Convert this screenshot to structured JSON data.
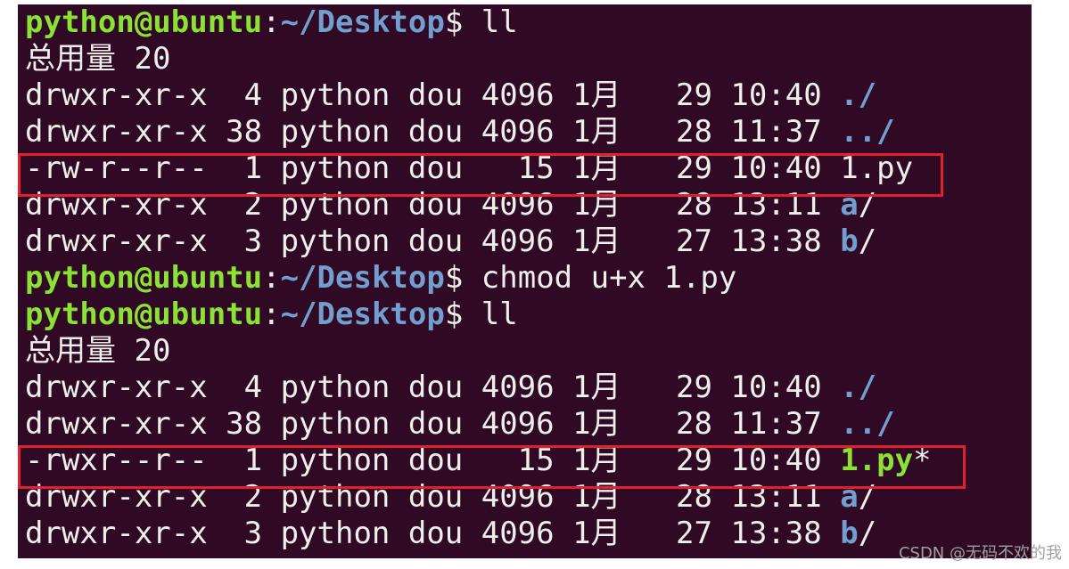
{
  "terminal": {
    "colors": {
      "background": "#300a24",
      "text": "#eeeeec",
      "prompt_user": "#8ae234",
      "prompt_path": "#729fcf",
      "highlight_box": "#e0202e"
    },
    "prompt": {
      "user": "python@ubuntu",
      "colon": ":",
      "path": "~/Desktop",
      "symbol": "$ "
    },
    "cmd1": "ll",
    "total1": "总用量 20",
    "listing1": {
      "row1_perms": "drwxr-xr-x  4 python dou 4096 1月   29 10:40 ",
      "row1_name": "./",
      "row2_perms": "drwxr-xr-x 38 python dou 4096 1月   28 11:37 ",
      "row2_name": "../",
      "row3_perms": "-rw-r--r--  1 python dou   15 1月   29 10:40 ",
      "row3_name": "1.py",
      "row4_perms": "drwxr-xr-x  2 python dou 4096 1月   28 13:11 ",
      "row4_name": "a",
      "row4_slash": "/",
      "row5_perms": "drwxr-xr-x  3 python dou 4096 1月   27 13:38 ",
      "row5_name": "b",
      "row5_slash": "/"
    },
    "cmd2": "chmod u+x 1.py",
    "cmd3": "ll",
    "total2": "总用量 20",
    "listing2": {
      "row1_perms": "drwxr-xr-x  4 python dou 4096 1月   29 10:40 ",
      "row1_name": "./",
      "row2_perms": "drwxr-xr-x 38 python dou 4096 1月   28 11:37 ",
      "row2_name": "../",
      "row3_perms": "-rwxr--r--  1 python dou   15 1月   29 10:40 ",
      "row3_name": "1.py",
      "row3_suffix": "*",
      "row4_perms": "drwxr-xr-x  2 python dou 4096 1月   28 13:11 ",
      "row4_name": "a",
      "row4_slash": "/",
      "row5_perms": "drwxr-xr-x  3 python dou 4096 1月   27 13:38 ",
      "row5_name": "b",
      "row5_slash": "/"
    }
  },
  "watermark": "CSDN @无码不欢的我"
}
